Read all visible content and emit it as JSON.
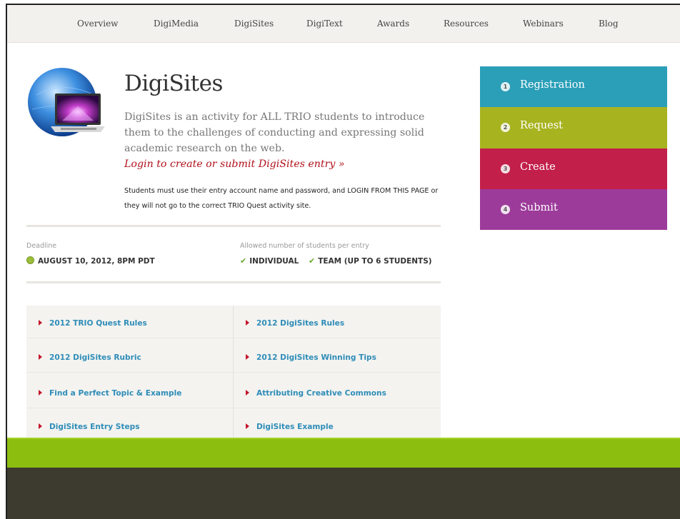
{
  "nav": {
    "items": [
      "Overview",
      "DigiMedia",
      "DigiSites",
      "DigiText",
      "Awards",
      "Resources",
      "Webinars",
      "Blog"
    ]
  },
  "hero": {
    "title": "DigiSites",
    "description": "DigiSites is an activity for ALL TRIO students to introduce them to the challenges of conducting and expressing solid academic research on the web.",
    "login_link": "Login to create or submit DigiSites entry »",
    "note": "Students must use their entry account name and password, and LOGIN FROM THIS PAGE or they will not go to the correct TRIO Quest activity site."
  },
  "meta": {
    "deadline_label": "Deadline",
    "deadline_value": "AUGUST 10, 2012, 8PM PDT",
    "allowed_label": "Allowed number of students per entry",
    "allowed_options": [
      "INDIVIDUAL",
      "TEAM (UP TO 6 STUDENTS)"
    ]
  },
  "links": {
    "left": [
      "2012 TRIO Quest Rules",
      "2012 DigiSites Rubric",
      "Find a Perfect Topic & Example",
      "DigiSites Entry Steps"
    ],
    "right": [
      "2012 DigiSites Rules",
      "2012 DigiSites Winning Tips",
      "Attributing Creative Commons",
      "DigiSites Example"
    ]
  },
  "steps": [
    {
      "num": "1",
      "label": "Registration",
      "color": "#2b9fb8"
    },
    {
      "num": "2",
      "label": "Request",
      "color": "#a8b320"
    },
    {
      "num": "3",
      "label": "Create",
      "color": "#c21f4a"
    },
    {
      "num": "4",
      "label": "Submit",
      "color": "#9c3b9a"
    }
  ],
  "colors": {
    "accent_red": "#b0121b",
    "link_blue": "#2f8db8",
    "footer_green": "#8cbe10",
    "footer_dark": "#3d3a2f"
  }
}
